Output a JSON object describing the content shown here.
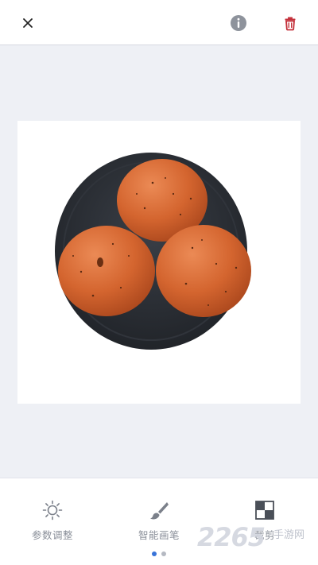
{
  "top_bar": {
    "close_icon": "close-icon",
    "info_icon": "info-icon",
    "delete_icon": "trash-icon"
  },
  "image": {
    "subject": "three-buns-on-plate"
  },
  "toolbar": {
    "tools": [
      {
        "label": "参数调整",
        "icon": "sun-icon"
      },
      {
        "label": "智能画笔",
        "icon": "brush-icon"
      },
      {
        "label": "裁剪",
        "icon": "crop-icon"
      }
    ],
    "pages": {
      "count": 2,
      "active": 1
    }
  },
  "watermark": {
    "number": "2265",
    "text": "手游网"
  },
  "colors": {
    "delete": "#c4313b",
    "info": "#8e939c",
    "active_dot": "#3873d8",
    "bun": "#d86a36",
    "plate": "#2b2f35"
  }
}
